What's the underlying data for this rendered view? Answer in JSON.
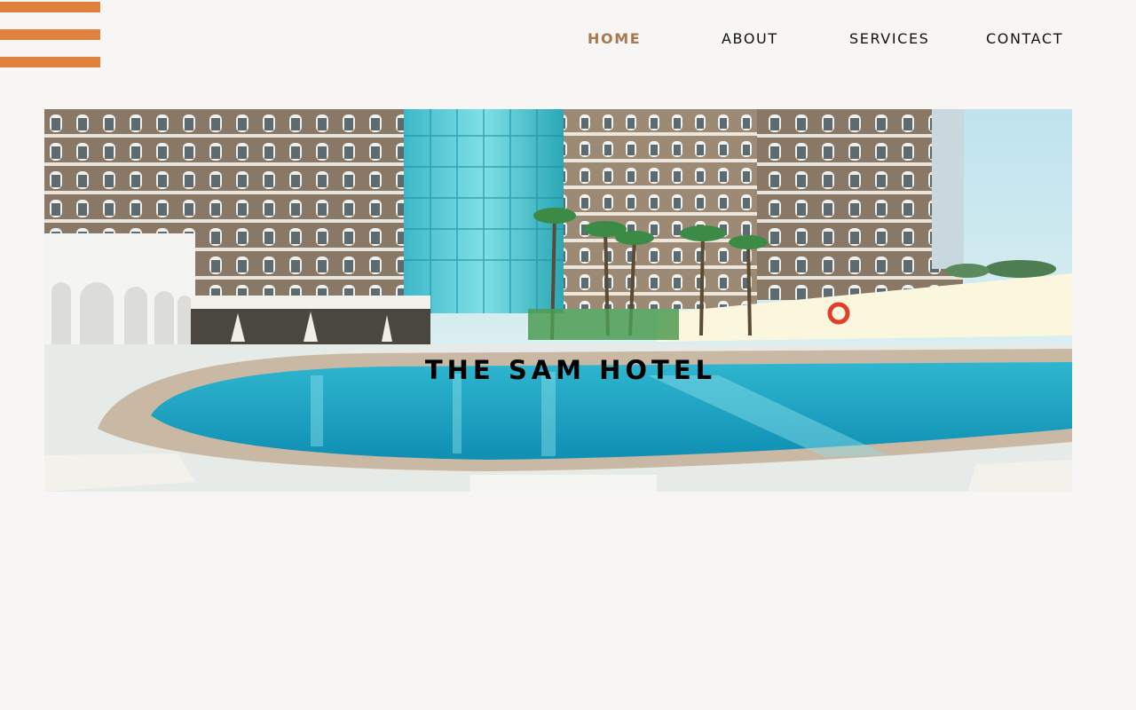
{
  "nav": {
    "items": [
      {
        "label": "HOME",
        "active": true
      },
      {
        "label": "ABOUT",
        "active": false
      },
      {
        "label": "SERVICES",
        "active": false
      },
      {
        "label": "CONTACT",
        "active": false
      }
    ]
  },
  "hero": {
    "title": "THE SAM HOTEL"
  },
  "colors": {
    "background": "#f7f6f4",
    "menu_bars": "#e0823e",
    "nav_active": "#a8784f",
    "nav_text": "#111111",
    "title": "#000000"
  }
}
